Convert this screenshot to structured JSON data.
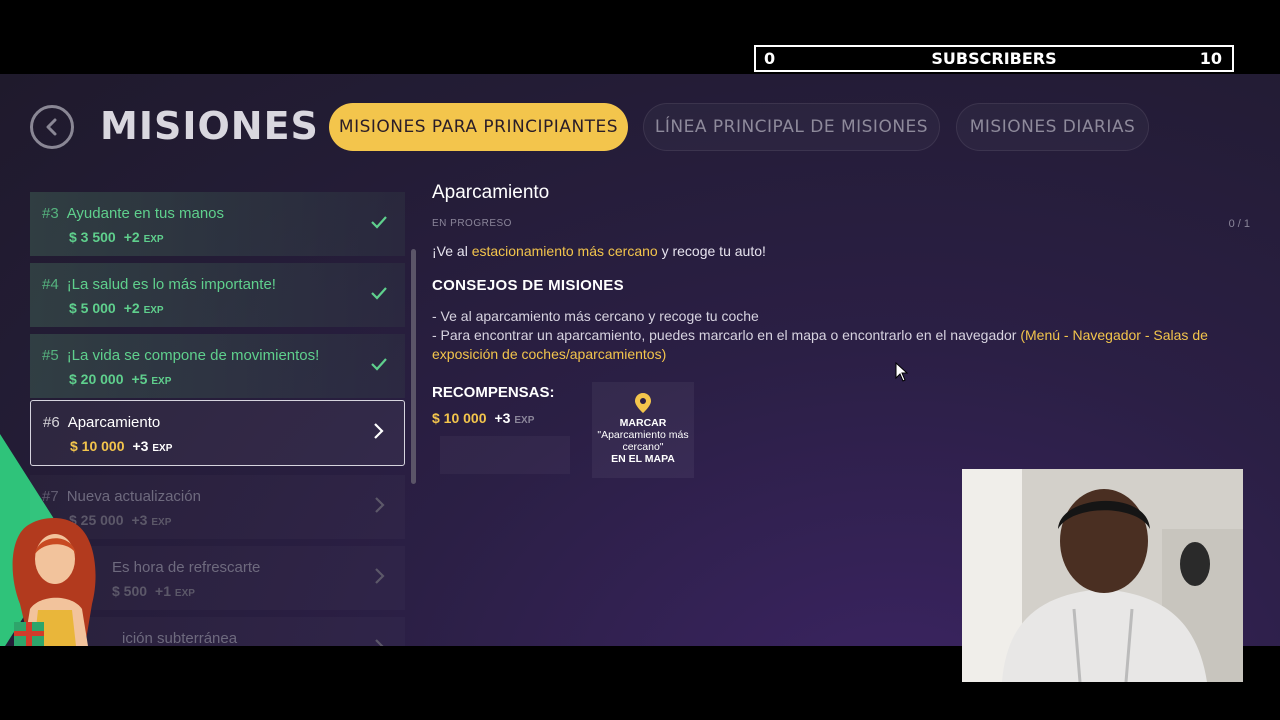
{
  "overlay": {
    "subscribers_left": "0",
    "subscribers_label": "SUBSCRIBERS",
    "subscribers_right": "10"
  },
  "header": {
    "title": "MISIONES",
    "tabs": [
      {
        "label": "MISIONES PARA PRINCIPIANTES",
        "active": true
      },
      {
        "label": "LÍNEA PRINCIPAL DE MISIONES",
        "active": false
      },
      {
        "label": "MISIONES DIARIAS",
        "active": false
      }
    ]
  },
  "missions": [
    {
      "num": "#3",
      "title": "Ayudante en tus manos",
      "money": "$ 3 500",
      "exp": "+2",
      "exp_unit": "EXP",
      "state": "done"
    },
    {
      "num": "#4",
      "title": "¡La salud es lo más importante!",
      "money": "$ 5 000",
      "exp": "+2",
      "exp_unit": "EXP",
      "state": "done"
    },
    {
      "num": "#5",
      "title": "¡La vida se compone de movimientos!",
      "money": "$ 20 000",
      "exp": "+5",
      "exp_unit": "EXP",
      "state": "done"
    },
    {
      "num": "#6",
      "title": "Aparcamiento",
      "money": "$ 10 000",
      "exp": "+3",
      "exp_unit": "EXP",
      "state": "selected"
    },
    {
      "num": "#7",
      "title": "Nueva actualización",
      "money": "$ 25 000",
      "exp": "+3",
      "exp_unit": "EXP",
      "state": "locked"
    },
    {
      "num": "",
      "title": "Es hora de refrescarte",
      "money": "$ 500",
      "exp": "+1",
      "exp_unit": "EXP",
      "state": "locked"
    },
    {
      "num": "",
      "title": "ición subterránea",
      "money": "",
      "exp": "",
      "exp_unit": "",
      "state": "locked"
    }
  ],
  "detail": {
    "title": "Aparcamiento",
    "status": "EN PROGRESO",
    "progress": "0 / 1",
    "goal_pre": "¡Ve al ",
    "goal_highlight": "estacionamiento más cercano",
    "goal_post": " y recoge tu auto!",
    "tips_title": "CONSEJOS DE MISIONES",
    "tip1": "- Ve al aparcamiento más cercano y recoge tu coche",
    "tip2_pre": " - Para encontrar un aparcamiento, puedes marcarlo en el mapa o encontrarlo en el navegador ",
    "tip2_highlight": "(Menú - Navegador - Salas de exposición de coches/aparcamientos)",
    "rewards_title": "RECOMPENSAS:",
    "reward_money": "$ 10 000",
    "reward_exp": "+3",
    "reward_exp_unit": "EXP",
    "map_line1": "MARCAR",
    "map_line2": "\"Aparcamiento más cercano\"",
    "map_line3": "EN EL MAPA"
  },
  "colors": {
    "accent": "#f3c54c",
    "done": "#5fd08d",
    "brand_green": "#2fc37a"
  }
}
